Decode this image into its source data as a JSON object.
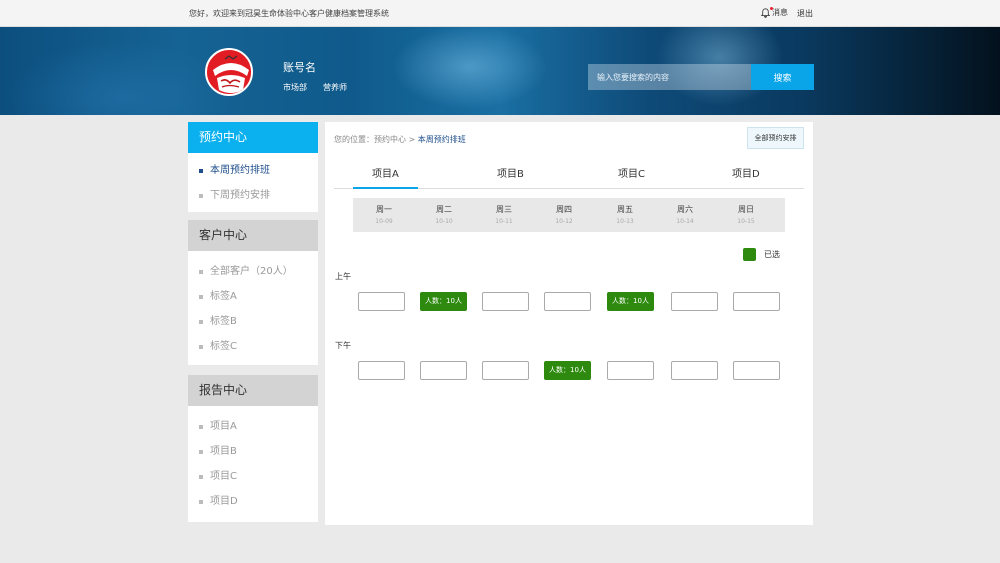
{
  "topbar": {
    "welcome": "您好，欢迎来到冠昊生命体验中心客户健康档案管理系统",
    "message_label": "消息",
    "logout_label": "退出"
  },
  "header": {
    "username": "账号名",
    "department": "市场部",
    "role": "营养师",
    "search_placeholder": "输入您要搜索的内容",
    "search_button": "搜索"
  },
  "sidebar": {
    "appointments": {
      "title": "预约中心",
      "items": [
        "本周预约排班",
        "下周预约安排"
      ]
    },
    "customers": {
      "title": "客户中心",
      "items": [
        "全部客户（20人）",
        "标签A",
        "标签B",
        "标签C"
      ]
    },
    "reports": {
      "title": "报告中心",
      "items": [
        "项目A",
        "项目B",
        "项目C",
        "项目D"
      ]
    }
  },
  "main": {
    "breadcrumb_prefix": "您的位置：预约中心 > ",
    "breadcrumb_current": "本周预约排班",
    "all_button": "全部预约安排",
    "tabs": [
      "项目A",
      "项目B",
      "项目C",
      "项目D"
    ],
    "active_tab": "项目A",
    "days": [
      {
        "name": "周一",
        "date": "10-09"
      },
      {
        "name": "周二",
        "date": "10-10"
      },
      {
        "name": "周三",
        "date": "10-11"
      },
      {
        "name": "周四",
        "date": "10-12"
      },
      {
        "name": "周五",
        "date": "10-13"
      },
      {
        "name": "周六",
        "date": "10-14"
      },
      {
        "name": "周日",
        "date": "10-15"
      }
    ],
    "legend_label": "已选",
    "legend_color": "#2d8a0e",
    "morning_label": "上午",
    "afternoon_label": "下午",
    "morning_slots": [
      "",
      "人数：10人",
      "",
      "",
      "人数：10人",
      "",
      ""
    ],
    "afternoon_slots": [
      "",
      "",
      "",
      "人数：10人",
      "",
      "",
      ""
    ]
  }
}
